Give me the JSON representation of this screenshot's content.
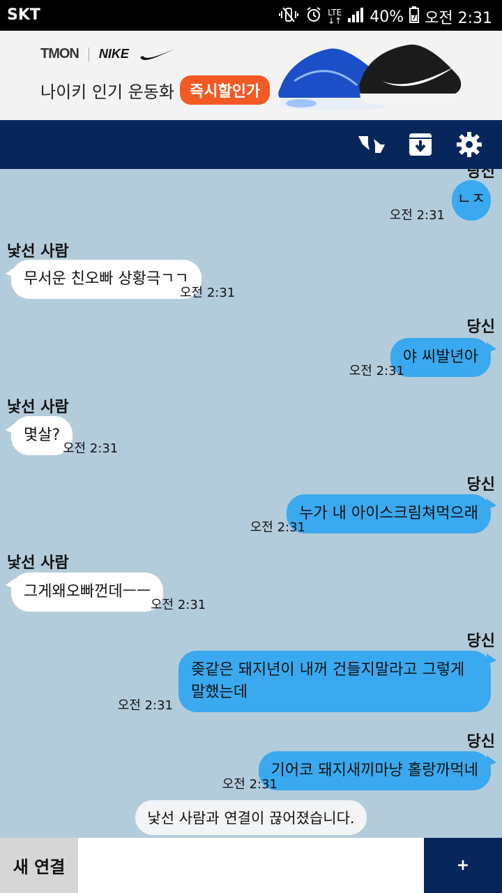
{
  "status_bar": {
    "carrier": "SKT",
    "network": "LTE",
    "battery": "40%",
    "time": "오전 2:31",
    "icons": [
      "mute-vibrate-icon",
      "alarm-icon",
      "lte-icon",
      "signal-icon",
      "battery-icon"
    ]
  },
  "ad": {
    "brand1": "TMON",
    "brand2": "NIKE",
    "headline": "나이키 인기 운동화",
    "cta": "즉시할인가",
    "accent_color": "#f25a24"
  },
  "header": {
    "bg_color": "#06265c",
    "icons": [
      "quote-icon",
      "archive-download-icon",
      "gear-icon"
    ]
  },
  "messages": [
    {
      "from": "you",
      "sender_label": "당신",
      "text": "ㄴㅈ",
      "time": "오전 2:31"
    },
    {
      "from": "stranger",
      "sender_label": "낯선 사람",
      "text": "무서운 친오빠 상황극ㄱㄱ",
      "time": "오전 2:31"
    },
    {
      "from": "you",
      "sender_label": "당신",
      "text": "야 씨발년아",
      "time": "오전 2:31"
    },
    {
      "from": "stranger",
      "sender_label": "낯선 사람",
      "text": "몇살?",
      "time": "오전 2:31"
    },
    {
      "from": "you",
      "sender_label": "당신",
      "text": "누가 내 아이스크림쳐먹으래",
      "time": "오전 2:31"
    },
    {
      "from": "stranger",
      "sender_label": "낯선 사람",
      "text": "그게왜오빠껀데ㅡㅡ",
      "time": "오전 2:31"
    },
    {
      "from": "you",
      "sender_label": "당신",
      "text_line1": "좆같은 돼지년이 내꺼 건들지말라고 그렇게",
      "text_line2": "말했는데",
      "time": "오전 2:31"
    },
    {
      "from": "you",
      "sender_label": "당신",
      "text": "기어코 돼지새끼마냥 홀랑까먹네",
      "time": "오전 2:31"
    }
  ],
  "system_message": "낯선 사람과 연결이 끊어졌습니다.",
  "bottom": {
    "new_connection": "새 연결",
    "input_value": "",
    "input_placeholder": "",
    "send_label": "+"
  },
  "colors": {
    "chat_bg": "#b3ccdb",
    "my_bubble": "#3aa9ef",
    "their_bubble": "#ffffff"
  }
}
